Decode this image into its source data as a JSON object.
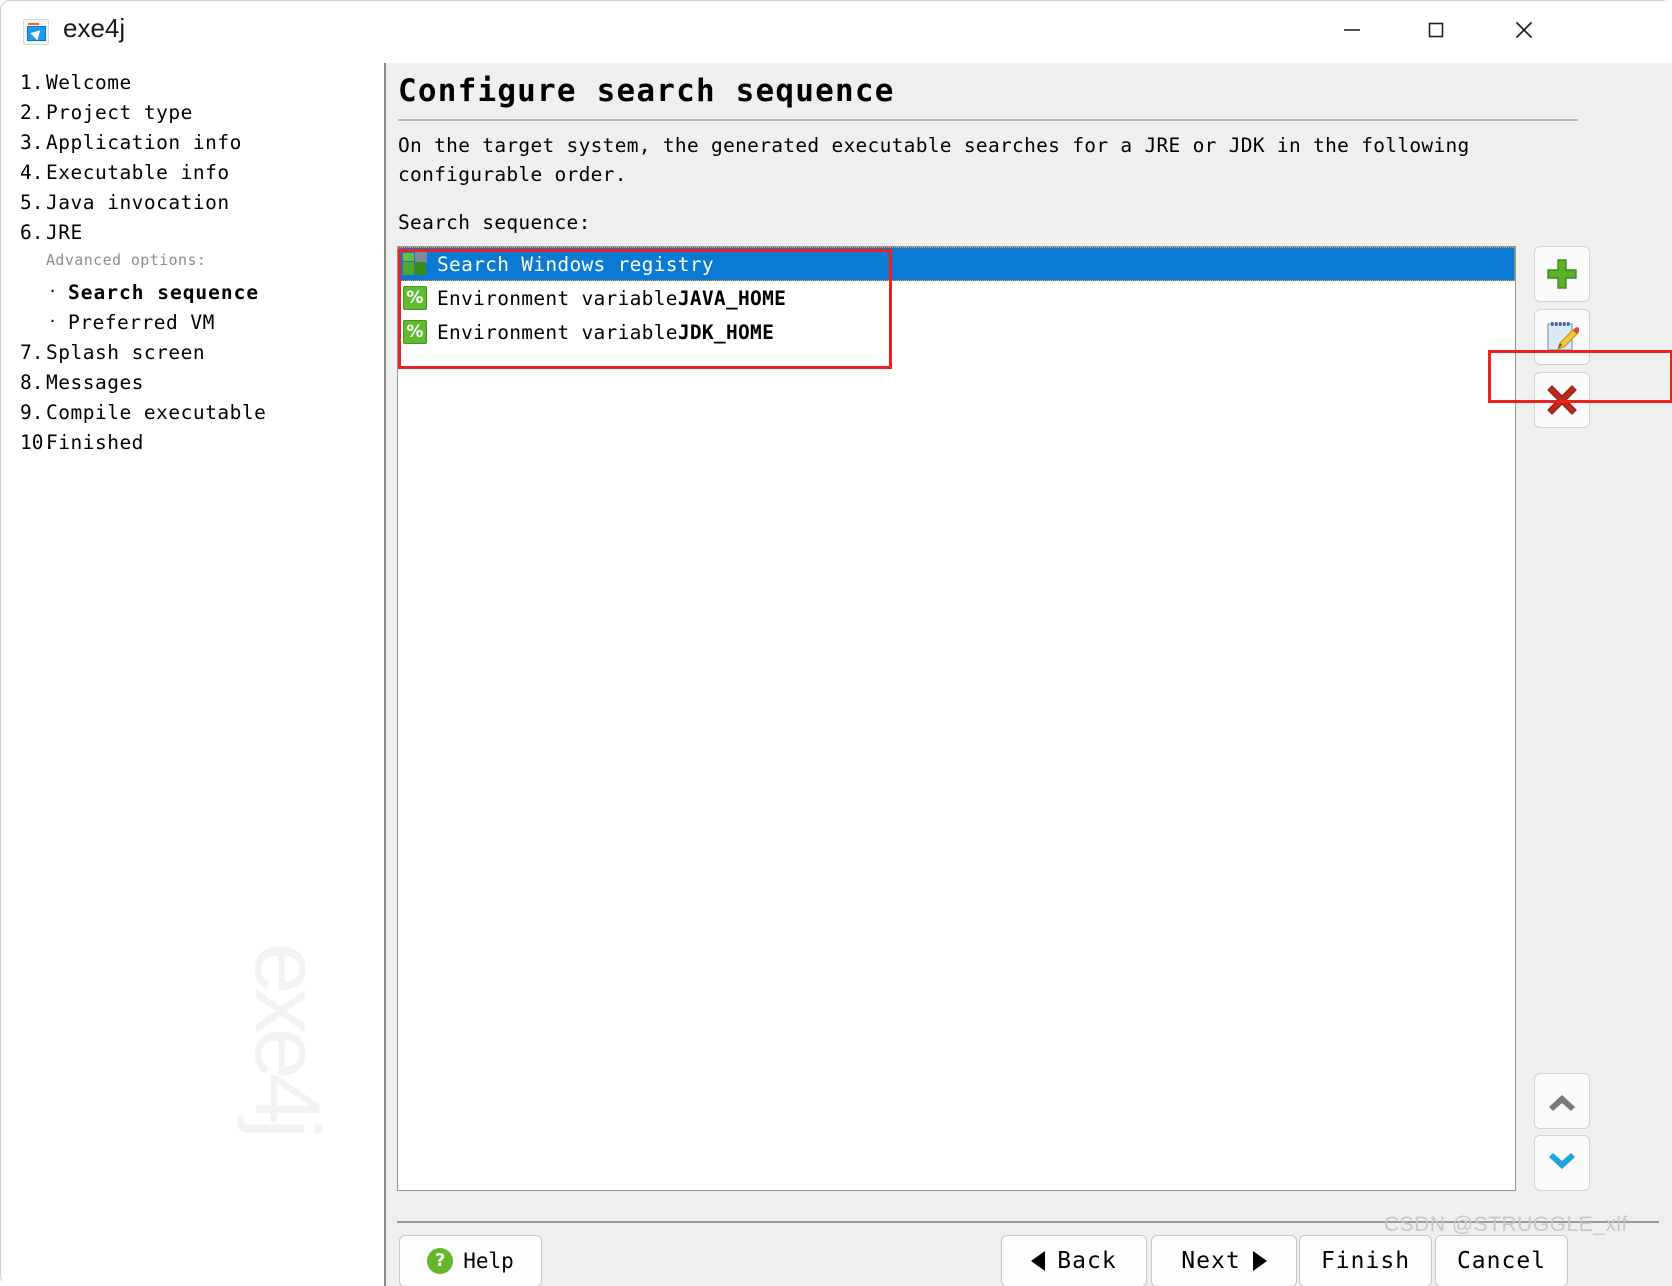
{
  "window": {
    "title": "exe4j",
    "icon": "exe4j-app-icon",
    "controls": {
      "minimize": "minimize-icon",
      "maximize": "maximize-icon",
      "close": "close-icon"
    }
  },
  "sidebar": {
    "watermark": "exe4j",
    "items": [
      {
        "num": "1.",
        "label": "Welcome",
        "active": false
      },
      {
        "num": "2.",
        "label": "Project type",
        "active": false
      },
      {
        "num": "3.",
        "label": "Application info",
        "active": false
      },
      {
        "num": "4.",
        "label": "Executable info",
        "active": false
      },
      {
        "num": "5.",
        "label": "Java invocation",
        "active": false
      },
      {
        "num": "6.",
        "label": "JRE",
        "active": false
      }
    ],
    "advanced_title": "Advanced options:",
    "advanced_items": [
      {
        "bullet": "·",
        "label": "Search sequence",
        "active": true
      },
      {
        "bullet": "·",
        "label": "Preferred VM",
        "active": false
      }
    ],
    "items_after": [
      {
        "num": "7.",
        "label": "Splash screen",
        "active": false
      },
      {
        "num": "8.",
        "label": "Messages",
        "active": false
      },
      {
        "num": "9.",
        "label": "Compile executable",
        "active": false
      },
      {
        "num": "10.",
        "label": "Finished",
        "active": false
      }
    ]
  },
  "main": {
    "title": "Configure search sequence",
    "description": "On the target system, the generated executable searches for a JRE or JDK in the following configurable order.",
    "list_label": "Search sequence:",
    "list_items": [
      {
        "icon": "windows-registry-icon",
        "text": "Search Windows registry",
        "variable": "",
        "selected": true
      },
      {
        "icon": "percent-icon",
        "text": "Environment variable ",
        "variable": "JAVA_HOME",
        "selected": false
      },
      {
        "icon": "percent-icon",
        "text": "Environment variable ",
        "variable": "JDK_HOME",
        "selected": false
      }
    ],
    "toolbar": {
      "add": "add-icon",
      "edit": "edit-icon",
      "delete": "delete-icon",
      "move_up": "chevron-up-icon",
      "move_down": "chevron-down-icon"
    }
  },
  "footer": {
    "help": "Help",
    "back": "Back",
    "next": "Next",
    "finish": "Finish",
    "cancel": "Cancel"
  },
  "watermark": "CSDN @STRUGGLE_xlf",
  "colors": {
    "selection_blue": "#0a7ad4",
    "annotation_red": "#f02020",
    "icon_green": "#5fbb30",
    "panel_gray": "#efefef"
  }
}
